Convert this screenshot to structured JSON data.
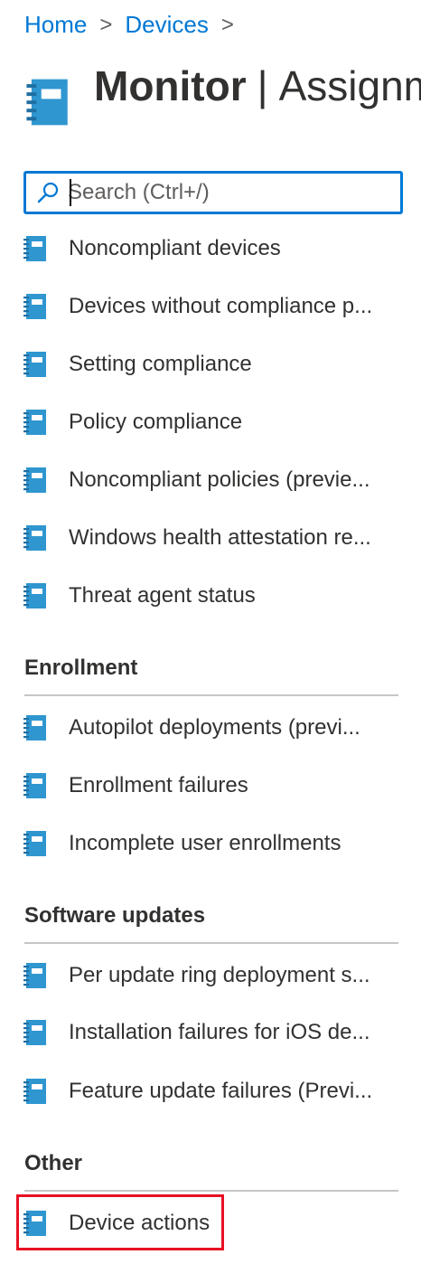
{
  "breadcrumb": {
    "items": [
      "Home",
      "Devices"
    ],
    "separator": ">"
  },
  "header": {
    "title_main": "Monitor",
    "title_sep": "|",
    "title_sub": "Assignm"
  },
  "search": {
    "placeholder": "Search (Ctrl+/)",
    "value": ""
  },
  "nav": {
    "items": [
      "Noncompliant devices",
      "Devices without compliance p...",
      "Setting compliance",
      "Policy compliance",
      "Noncompliant policies (previe...",
      "Windows health attestation re...",
      "Threat agent status"
    ]
  },
  "sections": [
    {
      "header": "Enrollment",
      "items": [
        "Autopilot deployments (previ...",
        "Enrollment failures",
        "Incomplete user enrollments"
      ]
    },
    {
      "header": "Software updates",
      "items": [
        "Per update ring deployment s...",
        "Installation failures for iOS de...",
        "Feature update failures (Previ..."
      ]
    },
    {
      "header": "Other",
      "items": [
        "Device actions"
      ]
    }
  ],
  "colors": {
    "accent": "#0078d4",
    "icon_blue": "#2f96d0",
    "highlight": "#e81123"
  },
  "icons": {
    "nav_item": "notebook-icon",
    "search": "search-icon",
    "breadcrumb_separator": "chevron-right-icon"
  }
}
